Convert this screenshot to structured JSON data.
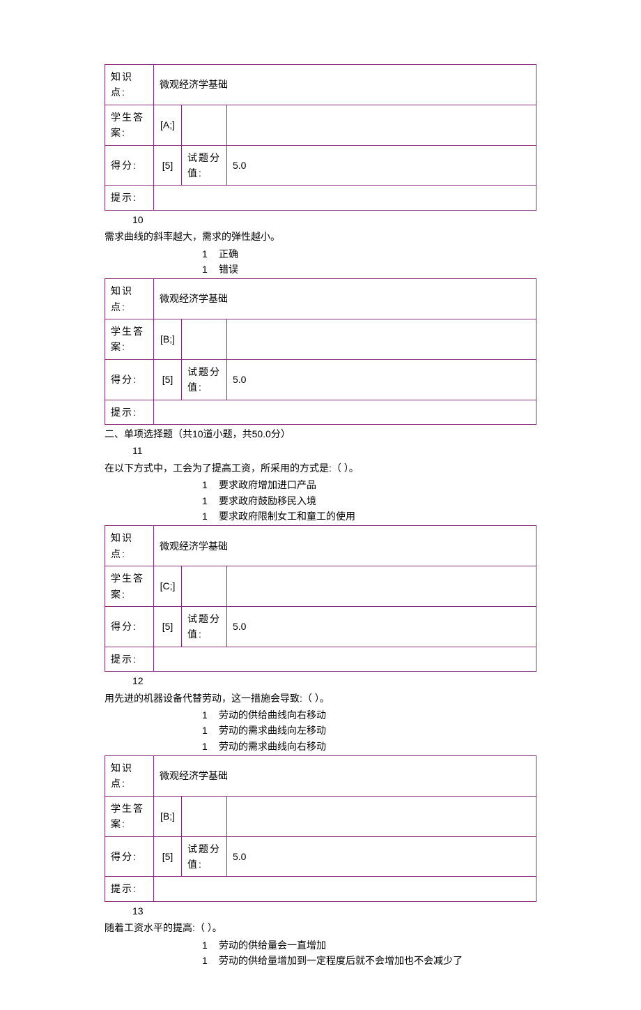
{
  "labels": {
    "knowledge": "知识点:",
    "student_ans": "学生答案:",
    "score": "得分:",
    "item_score": "试题分值:",
    "hint": "提示:"
  },
  "section_single": "二、单项选择题（共10道小题，共50.0分）",
  "blocks": [
    {
      "kp": "微观经济学基础",
      "ans": "[A;]",
      "score": "[5]",
      "val": "5.0"
    },
    {
      "num": "10",
      "text": "需求曲线的斜率越大，需求的弹性越小。",
      "opts": [
        "正确",
        "错误"
      ],
      "kp": "微观经济学基础",
      "ans": "[B;]",
      "score": "[5]",
      "val": "5.0"
    },
    {
      "num": "11",
      "text": "在以下方式中，工会为了提高工资，所采用的方式是:（ ）。",
      "opts": [
        "要求政府增加进口产品",
        "要求政府鼓励移民入境",
        "要求政府限制女工和童工的使用"
      ],
      "kp": "微观经济学基础",
      "ans": "[C;]",
      "score": "[5]",
      "val": "5.0"
    },
    {
      "num": "12",
      "text": "用先进的机器设备代替劳动，这一措施会导致:（ ）。",
      "opts": [
        "劳动的供给曲线向右移动",
        "劳动的需求曲线向左移动",
        "劳动的需求曲线向右移动"
      ],
      "kp": "微观经济学基础",
      "ans": "[B;]",
      "score": "[5]",
      "val": "5.0"
    },
    {
      "num": "13",
      "text": "随着工资水平的提高:（ ）。",
      "opts": [
        "劳动的供给量会一直增加",
        "劳动的供给量增加到一定程度后就不会增加也不会减少了"
      ]
    }
  ]
}
